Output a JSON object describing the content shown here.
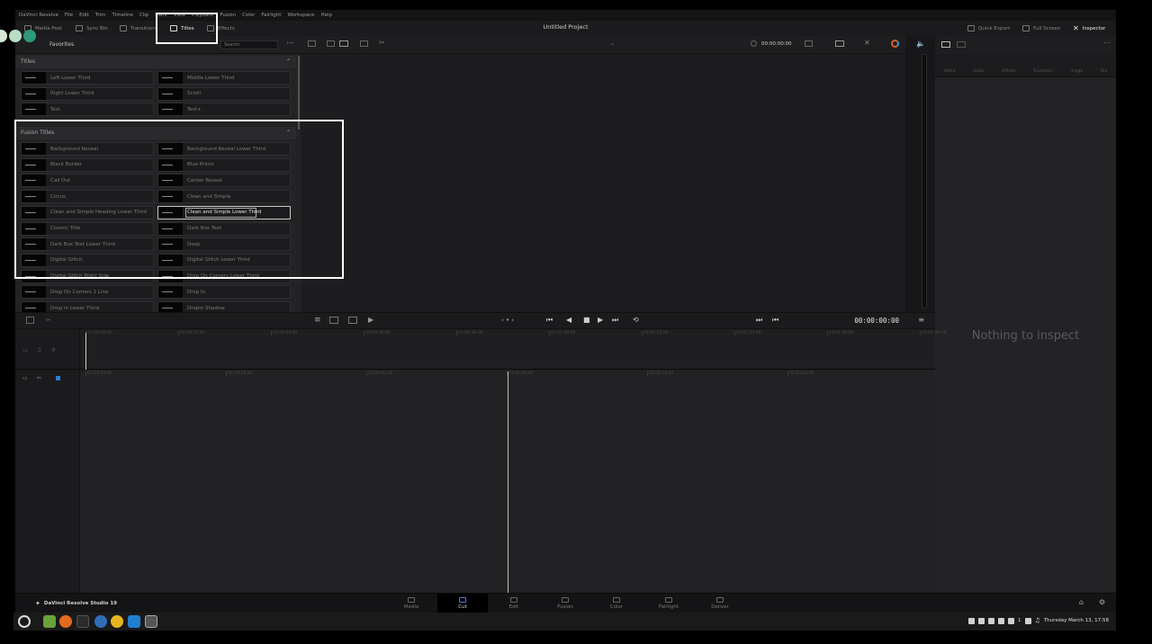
{
  "menubar": [
    "DaVinci Resolve",
    "File",
    "Edit",
    "Trim",
    "Timeline",
    "Clip",
    "Mark",
    "View",
    "Playback",
    "Fusion",
    "Color",
    "Fairlight",
    "Workspace",
    "Help"
  ],
  "toolbar": {
    "media_pool": "Media Pool",
    "sync_bin": "Sync Bin",
    "transitions": "Transitions",
    "titles": "Titles",
    "effects": "Effects",
    "project_title": "Untitled Project",
    "quick_export": "Quick Export",
    "full_screen": "Full Screen",
    "inspector": "Inspector"
  },
  "left_panel": {
    "favorites": "Favorites",
    "search_placeholder": "Search",
    "titles_header": "Titles",
    "fusion_header": "Fusion Titles",
    "titles": [
      "Left Lower Third",
      "Middle Lower Third",
      "Right Lower Third",
      "Scroll",
      "Text",
      "Text+"
    ],
    "fusion_titles": [
      "Background Reveal",
      "Background Reveal Lower Third",
      "Black Border",
      "Blue Prints",
      "Call Out",
      "Center Reveal",
      "Circus",
      "Clean and Simple",
      "Clean and Simple Heading Lower Third",
      "Clean and Simple Lower Third",
      "Cosmic Title",
      "Dark Box Text",
      "Dark Box Text Lower Third",
      "Deep",
      "Digital Glitch",
      "Digital Glitch Lower Third",
      "Digital Glitch Right Side",
      "Drop On Corners Lower Third",
      "Drop On Corners 1 Line",
      "Drop In",
      "Drop In Lower Third",
      "Dropin Shadow"
    ],
    "selected_title": "Clean and Simple Lower Third"
  },
  "viewer": {
    "timecode": "00:00:00:00"
  },
  "inspector": {
    "tabs": [
      "Video",
      "Audio",
      "Effects",
      "Transition",
      "Image",
      "File"
    ],
    "empty_message": "Nothing to inspect"
  },
  "transport": {
    "timecode": "00:00:00:00"
  },
  "upper_ruler": [
    "01:00:00:00",
    "01:00:12:00",
    "01:00:24:00",
    "01:00:36:00",
    "01:00:48:00",
    "01:01:00:00",
    "01:01:12:00",
    "01:01:24:00",
    "01:01:36:00",
    "01:01:48:00"
  ],
  "lower_ruler": [
    "00:59:54:00",
    "00:59:58:00",
    "01:00:02:00",
    "01:00:06:00",
    "01:00:10:00",
    "01:00:14:00"
  ],
  "pages": {
    "brand": "DaVinci Resolve Studio 19",
    "tabs": [
      "Media",
      "Cut",
      "Edit",
      "Fusion",
      "Color",
      "Fairlight",
      "Deliver"
    ],
    "active": "Cut"
  },
  "taskbar": {
    "datetime": "Thursday March 13, 17:58",
    "badge": "1"
  },
  "colors": {
    "accent": "#4e7bd6",
    "panel": "#232325",
    "active_dot": "#2c9a7b"
  }
}
